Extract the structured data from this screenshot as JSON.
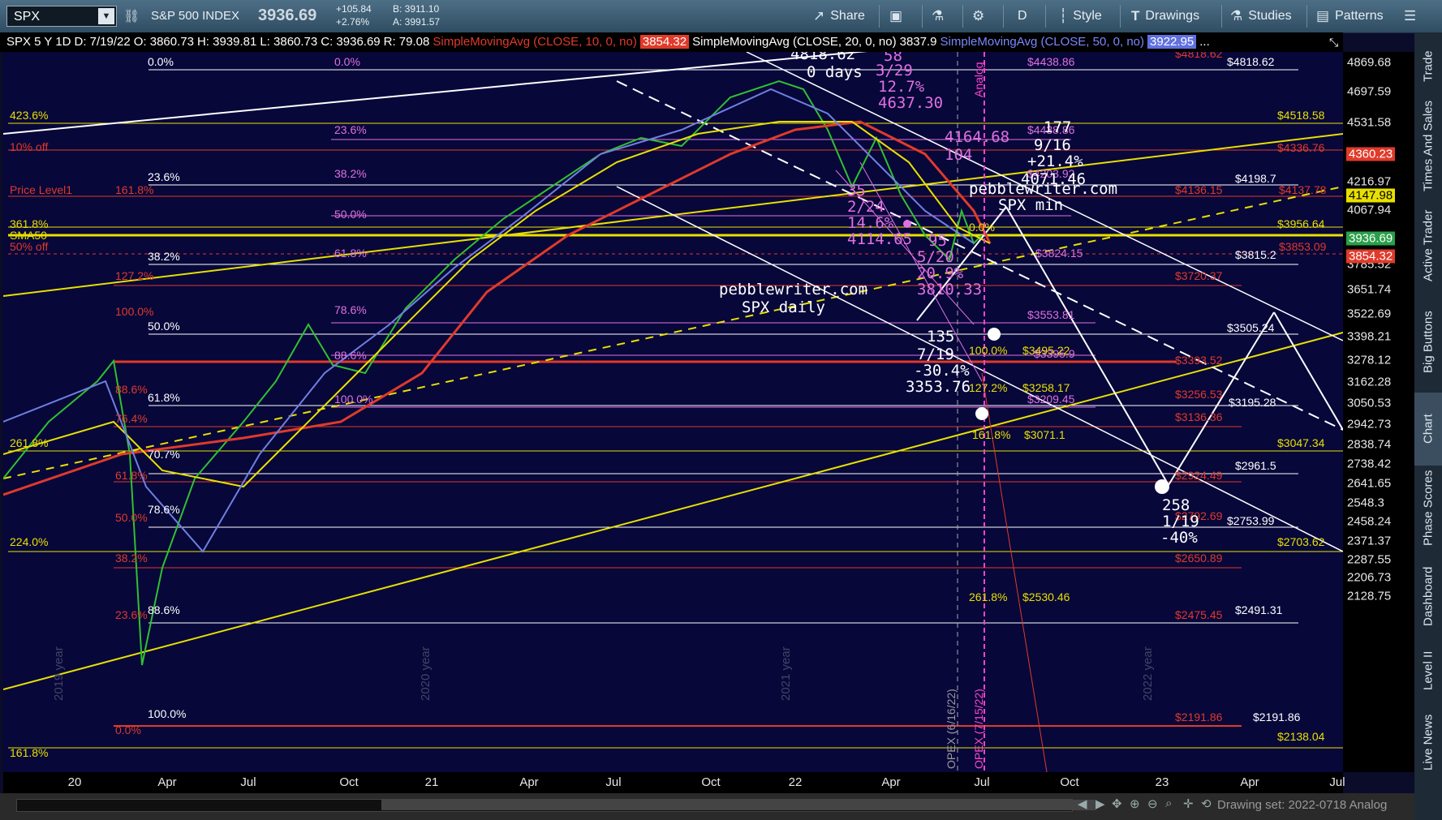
{
  "toolbar": {
    "symbol": "SPX",
    "index_name": "S&P 500 INDEX",
    "last": "3936.69",
    "change": "+105.84",
    "change_pct": "+2.76%",
    "bid": "B: 3911.10",
    "ask": "A: 3991.57",
    "buttons": {
      "share": "Share",
      "period": "D",
      "style": "Style",
      "drawings": "Drawings",
      "studies": "Studies",
      "patterns": "Patterns"
    }
  },
  "infobar": {
    "title": "SPX 5 Y 1D",
    "date": "D: 7/19/22",
    "open": "O: 3860.73",
    "high": "H: 3939.81",
    "low": "L: 3860.73",
    "close": "C: 3936.69",
    "range": "R: 79.08",
    "sma10_label": "SimpleMovingAvg (CLOSE, 10, 0, no)",
    "sma10_value": "3854.32",
    "sma20_label": "SimpleMovingAvg (CLOSE, 20, 0, no)",
    "sma20_value": "3837.9",
    "sma50_label": "SimpleMovingAvg (CLOSE, 50, 0, no)",
    "sma50_value": "3922.95",
    "more": "..."
  },
  "price_axis": {
    "labels": [
      "4869.68",
      "4697.59",
      "4531.58",
      "4216.97",
      "4067.94",
      "3785.52",
      "3651.74",
      "3522.69",
      "3398.21",
      "3278.12",
      "3162.28",
      "3050.53",
      "2942.73",
      "2838.74",
      "2738.42",
      "2641.65",
      "2548.3",
      "2458.24",
      "2371.37",
      "2287.55",
      "2206.73",
      "2128.75"
    ],
    "tags": [
      {
        "text": "4360.23",
        "color": "#e03a2a"
      },
      {
        "text": "4147.98",
        "color": "#e8e000"
      },
      {
        "text": "3936.69",
        "color": "#2aa04a"
      },
      {
        "text": "3854.32",
        "color": "#e03a2a"
      }
    ]
  },
  "date_axis": [
    "20",
    "Apr",
    "Jul",
    "Oct",
    "21",
    "Apr",
    "Jul",
    "Oct",
    "22",
    "Apr",
    "Jul",
    "Oct",
    "23",
    "Apr",
    "Jul"
  ],
  "chart_labels": {
    "fib_left": [
      "423.6%",
      "10% off",
      "Price Level1",
      "161.8%",
      "361.8%",
      "SMA50",
      "50% off",
      "127.2%",
      "100.0%",
      "88.6%",
      "76.4%",
      "261.8%",
      "61.8%",
      "50.0%",
      "38.2%",
      "23.6%",
      "224.0%",
      "0.0%",
      "161.8%"
    ],
    "fib_white": [
      "0.0%",
      "23.6%",
      "38.2%",
      "50.0%",
      "61.8%",
      "70.7%",
      "78.6%",
      "88.6%",
      "100.0%"
    ],
    "fib_magenta": [
      "0.0%",
      "23.6%",
      "38.2%",
      "50.0%",
      "61.8%",
      "78.6%",
      "88.6%",
      "100.0%"
    ],
    "right_white": [
      "$4818.62",
      "$4198.7",
      "$3815.2",
      "$3505.24",
      "$3195.28",
      "$2961.5",
      "$2753.99",
      "$2491.31",
      "$2191.86",
      "$4818.62"
    ],
    "right_yellow": [
      "$4518.58",
      "$3956.64",
      "$3047.34",
      "$2703.62",
      "$2138.04",
      "$4137.78"
    ],
    "right_red": [
      "$4336.76",
      "$4136.15",
      "$3720.37",
      "$3393.52",
      "$3256.53",
      "$3136.36",
      "$2924.49",
      "$2792.69",
      "$2650.89",
      "$2475.45",
      "$2191.86",
      "$3853.09"
    ],
    "mid_magenta": [
      "$4438.86",
      "$4203.92",
      "$3824.15",
      "$3553.81",
      "$3209.45",
      "$3395.9"
    ],
    "mid_yellow": [
      "100.0%",
      "$3495.22",
      "127.2%",
      "$3258.17",
      "161.8%",
      "$3071.1",
      "261.8%",
      "$2530.46",
      "0.0%"
    ],
    "annotations": [
      "4818.62",
      "0 days",
      "58",
      "3/29",
      "12.7%",
      "4637.30",
      "4164.68",
      "104",
      "177",
      "9/16",
      "+21.4%",
      "4071.46",
      "pebblewriter.com",
      "SPX min",
      "35",
      "2/24",
      "14.6%",
      "4114.65",
      "95",
      "5/20",
      "20.9%",
      "3810.33",
      "pebblewriter.com",
      "SPX daily",
      "135",
      "7/19",
      "-30.4%",
      "3353.76",
      "258",
      "1/19",
      "-40%"
    ],
    "vertical_labels": [
      "2019 year",
      "2020 year",
      "2021 year",
      "2022 year",
      "OPEX (6/16/22)",
      "Analog",
      "OPEX (7/15/22)"
    ]
  },
  "sidebar_tabs": [
    "Trade",
    "Times And Sales",
    "Active Trader",
    "Big Buttons",
    "Chart",
    "Phase Scores",
    "Dashboard",
    "Level II",
    "Live News"
  ],
  "bottom": {
    "drawing_set": "Drawing set: 2022-0718 Analog"
  },
  "colors": {
    "background": "#07073a",
    "yellow": "#e8e000",
    "red": "#e03a2a",
    "magenta": "#e070e0",
    "white": "#ffffff",
    "blue": "#6f7fe0"
  }
}
